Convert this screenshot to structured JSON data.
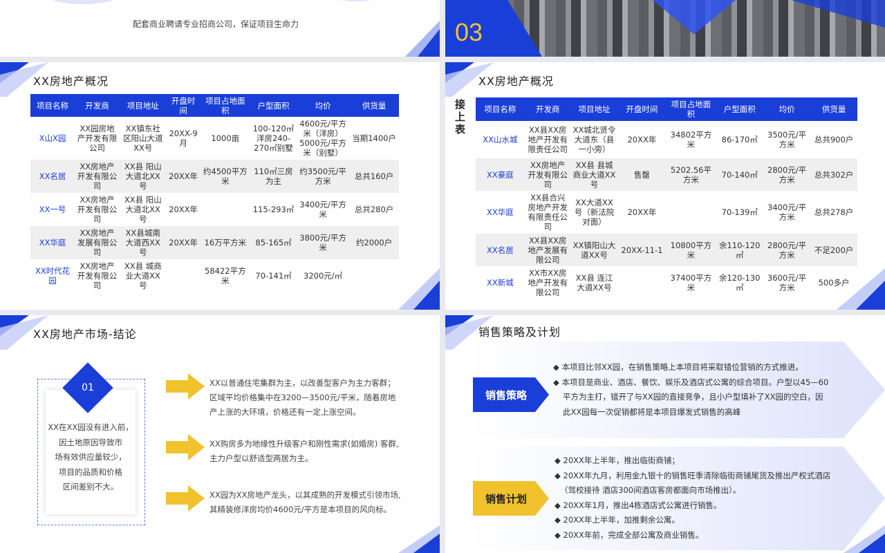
{
  "slide1": {
    "slogan": "配套商业聘请专业招商公司，保证项目生命力"
  },
  "slide2": {
    "section_number": "03"
  },
  "slide3": {
    "title": "XX房地产概况",
    "headers": [
      "项目名称",
      "开发商",
      "项目地址",
      "开盘时间",
      "项目占地面积",
      "户型面积",
      "均价",
      "供货量"
    ],
    "rows": [
      [
        "X山X园",
        "XX园房地产开发有限公司",
        "XX镇东社区阳山大道XX号",
        "20XX-9月",
        "1000亩",
        "100-120㎡洋房240-270㎡别墅",
        "4600元/平方米（洋房）5000元/平方米（别墅）",
        "当期1400户"
      ],
      [
        "XX名居",
        "XX房地产开发有限公司",
        "XX县 阳山大道北XX号",
        "20XX年",
        "约4500平方米",
        "110㎡三房为主",
        "约3500元/平方米",
        "总共160户"
      ],
      [
        "XX一号",
        "XX房地产开发有限公司",
        "XX县 阳山大道北XX号",
        "20XX年",
        "",
        "115-293㎡",
        "3400元/平方米",
        "总共280户"
      ],
      [
        "XX华庭",
        "XX房地产发展有限公司",
        "XX县城南大道西XX号",
        "20XX年",
        "16万平方米",
        "85-165㎡",
        "3800元/平方米",
        "约2000户"
      ],
      [
        "XX时代花园",
        "XX房地产开发有限公司",
        "XX县 城商业大道XX号",
        "",
        "58422平方米",
        "70-141㎡",
        "3200元/㎡",
        ""
      ]
    ]
  },
  "slide4": {
    "title": "XX房地产概况",
    "side_label": "接上表",
    "headers": [
      "项目名称",
      "开发商",
      "项目地址",
      "开盘时间",
      "项目占地面积",
      "户型面积",
      "均价",
      "供货量"
    ],
    "rows": [
      [
        "XX山水城",
        "XX县XX房地产开发有限责任公司",
        "XX城北贤令大道东（县一小旁）",
        "20XX年",
        "34802平方米",
        "86-170㎡",
        "3500元/平方米",
        "总共900户"
      ],
      [
        "XX豪庭",
        "XX房地产开发有限公司",
        "XX县 县城商业大道XX号",
        "售罄",
        "5202.56平方米",
        "70-140㎡",
        "2800元/平方米",
        "总共302户"
      ],
      [
        "XX华庭",
        "XX县合兴房地产开发有限责任公司",
        "XX大道XX号（新法院对面）",
        "20XX年",
        "",
        "70-139㎡",
        "3400元/平方米",
        "总共278户"
      ],
      [
        "XX名居",
        "XX县XX房地产发展有限公司",
        "XX镇阳山大道XX号",
        "20XX-11-1",
        "10800平方米",
        "余110-120㎡",
        "2800元/平方米",
        "不足200户"
      ],
      [
        "XX新城",
        "XX市XX房地产开发有限公司",
        "XX县 连江大道XX号",
        "",
        "37400平方米",
        "余120-130㎡",
        "3600元/平方米",
        "500多户"
      ]
    ]
  },
  "slide5": {
    "title": "XX房地产市场-结论",
    "badge": "01",
    "card_text": [
      "XX在XX园没有进入前，",
      "因土地原因导致市",
      "场有效供应量较少，",
      "项目的品质和价格",
      "区间差别不大。"
    ],
    "points": [
      [
        "XX以普通住宅集群为主，以改善型客户为主力客群；",
        "区域平均价格集中在3200—3500元/平米，随着房地",
        "产上涨的大环境，价格还有一定上涨空间。"
      ],
      [
        "XX购房多为地缘性升级客户和刚性需求(如婚房) 客群,",
        "主力户型以舒适型两居为主。"
      ],
      [
        "XX园为XX房地产龙头，以其成熟的开发模式引领市场,",
        "其精装修洋房均价4600元/平方是本项目的风向标。"
      ]
    ],
    "arrow_color": "#f2c12e"
  },
  "slide6": {
    "title": "销售策略及计划",
    "strategy_label": "销售策略",
    "strategy_lines": [
      "◆ 本项目比邻XX园，在销售策略上本项目将采取错位营销的方式推进。",
      "◆ 本项目是商业、酒店、餐饮、娱乐及酒店式公寓的综合项目。户型以45—60",
      "平方为主打，错开了与XX园的直接竞争，且小户型填补了XX园的空白，因",
      "此XX园每一次促销都将是本项目爆发式销售的高峰"
    ],
    "plan_label": "销售计划",
    "plan_lines": [
      "◆ 20XX年上半年，推出临街商铺；",
      "◆ 20XX年九月，利用金九银十的销售旺季清除临街商铺尾货及推出产权式酒店",
      "（驾校接待  酒店300间酒店客房都面向市场推出）。",
      "◆ 20XX年1月，推出4栋酒店式公寓进行销售。",
      "◆ 20XX年上半年，加推剩余公寓。",
      "◆ 20XX年前，完成全部公寓及商业销售。"
    ],
    "accent_blue": "#1a3ed8",
    "accent_yellow": "#f2c12e"
  }
}
